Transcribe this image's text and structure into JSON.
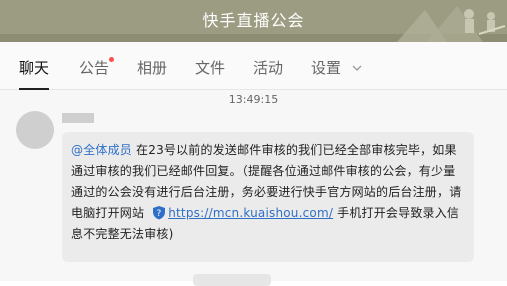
{
  "header": {
    "title": "快手直播公会"
  },
  "tabs": [
    {
      "label": "聊天",
      "active": true
    },
    {
      "label": "公告",
      "has_dot": true
    },
    {
      "label": "相册"
    },
    {
      "label": "文件"
    },
    {
      "label": "活动"
    },
    {
      "label": "设置"
    }
  ],
  "chat": {
    "time": "13:49:15",
    "message": {
      "mention": "@全体成员",
      "text_part1": " 在23号以前的发送邮件审核的我们已经全部审核完毕，如果通过审核的我们已经邮件回复。（提醒各位通过邮件审核的公会，有少量通过的公会没有进行后台注册，务必要进行快手官方网站的后台注册，请电脑打开网站 ",
      "link": "https://mcn.kuaishou.com/",
      "text_part2": " 手机打开会导致录入信息不完整无法审核)"
    }
  },
  "colors": {
    "header_bg": "#9c9c82",
    "link": "#2f6fc7",
    "notification_dot": "#ff4d4f"
  }
}
